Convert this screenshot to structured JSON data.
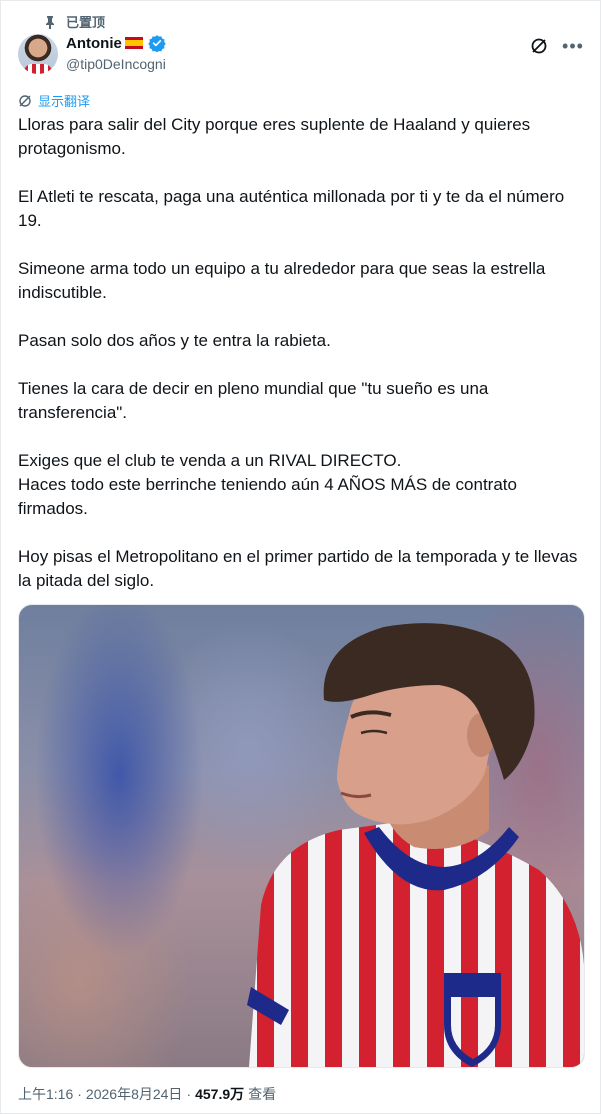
{
  "pinned": {
    "label": "已置顶"
  },
  "author": {
    "name": "Antonie",
    "handle": "@tip0DeIncogni"
  },
  "translate": {
    "label": "显示翻译"
  },
  "tweet": {
    "paragraphs": [
      "Lloras para salir del City porque eres suplente de Haaland y quieres protagonismo.",
      "El Atleti te rescata, paga una auténtica millonada por ti y te da el número 19.",
      "Simeone arma todo un equipo a tu alrededor para que seas la estrella indiscutible.",
      "Pasan solo dos años y te entra la rabieta.",
      "Tienes la cara de decir en pleno mundial que \"tu sueño es una transferencia\".",
      "Exiges que el club te venda a un RIVAL DIRECTO.",
      "Haces todo este berrinche teniendo aún 4 AÑOS MÁS de contrato firmados.",
      "Hoy pisas el Metropolitano en el primer partido de la temporada y te llevas la pitada del siglo."
    ]
  },
  "footer": {
    "time": "上午1:16",
    "sep1": "·",
    "date": "2026年8月24日",
    "sep2": "·",
    "views_count": "457.9万",
    "views_label": "查看"
  },
  "colors": {
    "accent": "#1d9bf0",
    "secondary_text": "#536471",
    "text": "#0f1419"
  },
  "icons": [
    "pin-icon",
    "verified-icon",
    "grok-icon",
    "more-icon",
    "translate-icon"
  ]
}
